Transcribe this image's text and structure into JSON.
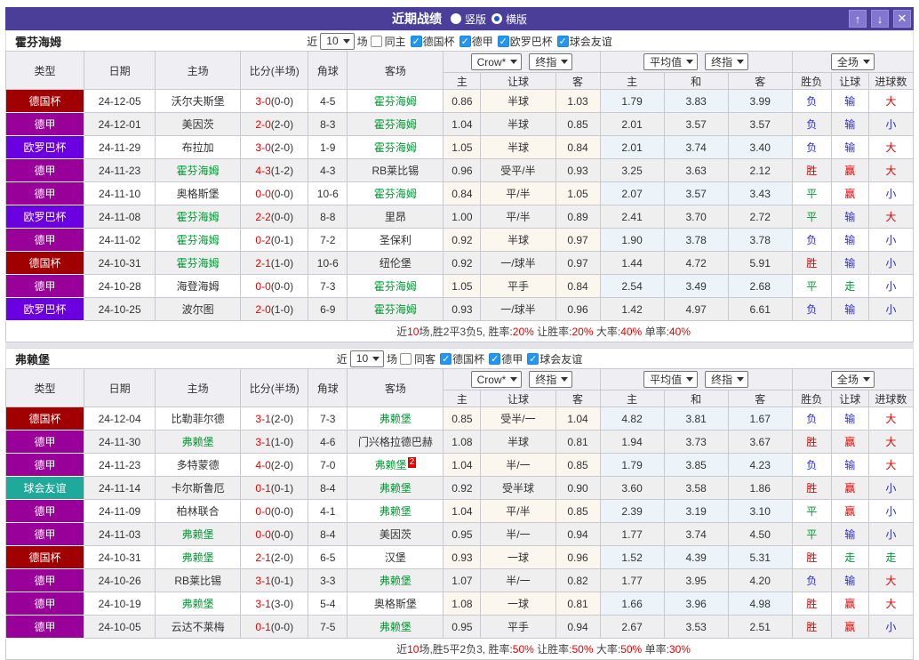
{
  "title_bar": {
    "title": "近期战绩",
    "layout_options": [
      {
        "label": "竖版",
        "selected": false
      },
      {
        "label": "横版",
        "selected": true
      }
    ],
    "buttons": [
      {
        "name": "move-up-button",
        "glyph": "↑"
      },
      {
        "name": "move-down-button",
        "glyph": "↓"
      },
      {
        "name": "close-button",
        "glyph": "✕"
      }
    ]
  },
  "colors": {
    "title_bar_bg": "#4a3e99",
    "type_colors": {
      "德国杯": "#a00000",
      "德甲": "#990099",
      "欧罗巴杯": "#6a00e0",
      "球会友谊": "#1fa99b"
    },
    "focal_team_green": "#009933",
    "win_red": "#e60000",
    "loss_blue": "#2b2bd5",
    "draw_green": "#009933",
    "odds_col_bg": "#fbf6ee",
    "avg_col_bg": "#ecf4fa"
  },
  "header": {
    "static_cols": [
      "类型",
      "日期",
      "主场",
      "比分(半场)",
      "角球",
      "客场"
    ],
    "groups": [
      {
        "selects": [
          {
            "label": "Crow*",
            "name": "bookmaker-select"
          },
          {
            "label": "终指",
            "name": "odds-time-select"
          }
        ],
        "subcols": [
          "主",
          "让球",
          "客"
        ]
      },
      {
        "selects": [
          {
            "label": "平均值",
            "name": "average-select"
          },
          {
            "label": "终指",
            "name": "avg-time-select"
          }
        ],
        "subcols": [
          "主",
          "和",
          "客"
        ]
      },
      {
        "selects": [
          {
            "label": "全场",
            "name": "period-select"
          }
        ],
        "subcols": [
          "胜负",
          "让球",
          "进球数"
        ]
      }
    ]
  },
  "sections": [
    {
      "team": "霍芬海姆",
      "filter": {
        "prefix": "近",
        "count": "10",
        "suffix": "场",
        "same": {
          "label": "同主",
          "checked": false
        },
        "leagues": [
          {
            "label": "德国杯",
            "checked": true
          },
          {
            "label": "德甲",
            "checked": true
          },
          {
            "label": "欧罗巴杯",
            "checked": true
          },
          {
            "label": "球会友谊",
            "checked": true
          }
        ]
      },
      "rows": [
        {
          "type": "德国杯",
          "date": "24-12-05",
          "home": {
            "name": "沃尔夫斯堡",
            "focal": false
          },
          "score": "3-0",
          "half": "(0-0)",
          "corners": "4-5",
          "away": {
            "name": "霍芬海姆",
            "focal": true
          },
          "odds": [
            "0.86",
            "半球",
            "1.03"
          ],
          "avg": [
            "1.79",
            "3.83",
            "3.99"
          ],
          "results": [
            [
              "负",
              "blue"
            ],
            [
              "输",
              "blue"
            ],
            [
              "大",
              "red"
            ]
          ]
        },
        {
          "type": "德甲",
          "date": "24-12-01",
          "home": {
            "name": "美因茨",
            "focal": false
          },
          "score": "2-0",
          "half": "(2-0)",
          "corners": "8-3",
          "away": {
            "name": "霍芬海姆",
            "focal": true
          },
          "odds": [
            "1.04",
            "半球",
            "0.85"
          ],
          "avg": [
            "2.01",
            "3.57",
            "3.57"
          ],
          "results": [
            [
              "负",
              "blue"
            ],
            [
              "输",
              "blue"
            ],
            [
              "小",
              "blue"
            ]
          ]
        },
        {
          "type": "欧罗巴杯",
          "date": "24-11-29",
          "home": {
            "name": "布拉加",
            "focal": false
          },
          "score": "3-0",
          "half": "(2-0)",
          "corners": "1-9",
          "away": {
            "name": "霍芬海姆",
            "focal": true
          },
          "odds": [
            "1.05",
            "半球",
            "0.84"
          ],
          "avg": [
            "2.01",
            "3.74",
            "3.40"
          ],
          "results": [
            [
              "负",
              "blue"
            ],
            [
              "输",
              "blue"
            ],
            [
              "大",
              "red"
            ]
          ]
        },
        {
          "type": "德甲",
          "date": "24-11-23",
          "home": {
            "name": "霍芬海姆",
            "focal": true
          },
          "score": "4-3",
          "half": "(1-2)",
          "corners": "4-3",
          "away": {
            "name": "RB莱比锡",
            "focal": false
          },
          "odds": [
            "0.96",
            "受平/半",
            "0.93"
          ],
          "avg": [
            "3.25",
            "3.63",
            "2.12"
          ],
          "results": [
            [
              "胜",
              "red"
            ],
            [
              "赢",
              "red"
            ],
            [
              "大",
              "red"
            ]
          ]
        },
        {
          "type": "德甲",
          "date": "24-11-10",
          "home": {
            "name": "奥格斯堡",
            "focal": false
          },
          "score": "0-0",
          "half": "(0-0)",
          "corners": "10-6",
          "away": {
            "name": "霍芬海姆",
            "focal": true
          },
          "odds": [
            "0.84",
            "平/半",
            "1.05"
          ],
          "avg": [
            "2.07",
            "3.57",
            "3.43"
          ],
          "results": [
            [
              "平",
              "green"
            ],
            [
              "赢",
              "red"
            ],
            [
              "小",
              "blue"
            ]
          ]
        },
        {
          "type": "欧罗巴杯",
          "date": "24-11-08",
          "home": {
            "name": "霍芬海姆",
            "focal": true
          },
          "score": "2-2",
          "half": "(0-0)",
          "corners": "8-8",
          "away": {
            "name": "里昂",
            "focal": false
          },
          "odds": [
            "1.00",
            "平/半",
            "0.89"
          ],
          "avg": [
            "2.41",
            "3.70",
            "2.72"
          ],
          "results": [
            [
              "平",
              "green"
            ],
            [
              "输",
              "blue"
            ],
            [
              "大",
              "red"
            ]
          ]
        },
        {
          "type": "德甲",
          "date": "24-11-02",
          "home": {
            "name": "霍芬海姆",
            "focal": true
          },
          "score": "0-2",
          "half": "(0-1)",
          "corners": "7-2",
          "away": {
            "name": "圣保利",
            "focal": false
          },
          "odds": [
            "0.92",
            "半球",
            "0.97"
          ],
          "avg": [
            "1.90",
            "3.78",
            "3.78"
          ],
          "results": [
            [
              "负",
              "blue"
            ],
            [
              "输",
              "blue"
            ],
            [
              "小",
              "blue"
            ]
          ]
        },
        {
          "type": "德国杯",
          "date": "24-10-31",
          "home": {
            "name": "霍芬海姆",
            "focal": true
          },
          "score": "2-1",
          "half": "(1-0)",
          "corners": "10-6",
          "away": {
            "name": "纽伦堡",
            "focal": false
          },
          "odds": [
            "0.92",
            "一/球半",
            "0.97"
          ],
          "avg": [
            "1.44",
            "4.72",
            "5.91"
          ],
          "results": [
            [
              "胜",
              "red"
            ],
            [
              "输",
              "blue"
            ],
            [
              "小",
              "blue"
            ]
          ]
        },
        {
          "type": "德甲",
          "date": "24-10-28",
          "home": {
            "name": "海登海姆",
            "focal": false
          },
          "score": "0-0",
          "half": "(0-0)",
          "corners": "7-3",
          "away": {
            "name": "霍芬海姆",
            "focal": true
          },
          "odds": [
            "1.05",
            "平手",
            "0.84"
          ],
          "avg": [
            "2.54",
            "3.49",
            "2.68"
          ],
          "results": [
            [
              "平",
              "green"
            ],
            [
              "走",
              "green"
            ],
            [
              "小",
              "blue"
            ]
          ]
        },
        {
          "type": "欧罗巴杯",
          "date": "24-10-25",
          "home": {
            "name": "波尔图",
            "focal": false
          },
          "score": "2-0",
          "half": "(1-0)",
          "corners": "6-9",
          "away": {
            "name": "霍芬海姆",
            "focal": true
          },
          "odds": [
            "0.93",
            "一/球半",
            "0.96"
          ],
          "avg": [
            "1.42",
            "4.97",
            "6.61"
          ],
          "results": [
            [
              "负",
              "blue"
            ],
            [
              "输",
              "blue"
            ],
            [
              "小",
              "blue"
            ]
          ]
        }
      ],
      "summary": [
        [
          "近",
          false
        ],
        [
          "10",
          true
        ],
        [
          "场,胜2平3负5, 胜率:",
          false
        ],
        [
          "20%",
          true
        ],
        [
          " 让胜率:",
          false
        ],
        [
          "20%",
          true
        ],
        [
          " 大率:",
          false
        ],
        [
          "40%",
          true
        ],
        [
          " 单率:",
          false
        ],
        [
          "40%",
          true
        ]
      ]
    },
    {
      "team": "弗赖堡",
      "filter": {
        "prefix": "近",
        "count": "10",
        "suffix": "场",
        "same": {
          "label": "同客",
          "checked": false
        },
        "leagues": [
          {
            "label": "德国杯",
            "checked": true
          },
          {
            "label": "德甲",
            "checked": true
          },
          {
            "label": "球会友谊",
            "checked": true
          }
        ]
      },
      "rows": [
        {
          "type": "德国杯",
          "date": "24-12-04",
          "home": {
            "name": "比勒菲尔德",
            "focal": false
          },
          "score": "3-1",
          "half": "(2-0)",
          "corners": "7-3",
          "away": {
            "name": "弗赖堡",
            "focal": true
          },
          "odds": [
            "0.85",
            "受半/一",
            "1.04"
          ],
          "avg": [
            "4.82",
            "3.81",
            "1.67"
          ],
          "results": [
            [
              "负",
              "blue"
            ],
            [
              "输",
              "blue"
            ],
            [
              "大",
              "red"
            ]
          ]
        },
        {
          "type": "德甲",
          "date": "24-11-30",
          "home": {
            "name": "弗赖堡",
            "focal": true
          },
          "score": "3-1",
          "half": "(1-0)",
          "corners": "4-6",
          "away": {
            "name": "门兴格拉德巴赫",
            "focal": false
          },
          "odds": [
            "1.08",
            "半球",
            "0.81"
          ],
          "avg": [
            "1.94",
            "3.73",
            "3.67"
          ],
          "results": [
            [
              "胜",
              "red"
            ],
            [
              "赢",
              "red"
            ],
            [
              "大",
              "red"
            ]
          ]
        },
        {
          "type": "德甲",
          "date": "24-11-23",
          "home": {
            "name": "多特蒙德",
            "focal": false
          },
          "score": "4-0",
          "half": "(2-0)",
          "corners": "7-0",
          "away": {
            "name": "弗赖堡",
            "focal": true,
            "sup": "2"
          },
          "odds": [
            "1.04",
            "半/一",
            "0.85"
          ],
          "avg": [
            "1.79",
            "3.85",
            "4.23"
          ],
          "results": [
            [
              "负",
              "blue"
            ],
            [
              "输",
              "blue"
            ],
            [
              "大",
              "red"
            ]
          ]
        },
        {
          "type": "球会友谊",
          "date": "24-11-14",
          "home": {
            "name": "卡尔斯鲁厄",
            "focal": false
          },
          "score": "0-1",
          "half": "(0-1)",
          "corners": "8-4",
          "away": {
            "name": "弗赖堡",
            "focal": true
          },
          "odds": [
            "0.92",
            "受半球",
            "0.90"
          ],
          "avg": [
            "3.60",
            "3.58",
            "1.86"
          ],
          "results": [
            [
              "胜",
              "red"
            ],
            [
              "赢",
              "red"
            ],
            [
              "小",
              "blue"
            ]
          ]
        },
        {
          "type": "德甲",
          "date": "24-11-09",
          "home": {
            "name": "柏林联合",
            "focal": false
          },
          "score": "0-0",
          "half": "(0-0)",
          "corners": "4-1",
          "away": {
            "name": "弗赖堡",
            "focal": true
          },
          "odds": [
            "1.04",
            "平/半",
            "0.85"
          ],
          "avg": [
            "2.39",
            "3.19",
            "3.10"
          ],
          "results": [
            [
              "平",
              "green"
            ],
            [
              "赢",
              "red"
            ],
            [
              "小",
              "blue"
            ]
          ]
        },
        {
          "type": "德甲",
          "date": "24-11-03",
          "home": {
            "name": "弗赖堡",
            "focal": true
          },
          "score": "0-0",
          "half": "(0-0)",
          "corners": "8-4",
          "away": {
            "name": "美因茨",
            "focal": false
          },
          "odds": [
            "0.95",
            "半/一",
            "0.94"
          ],
          "avg": [
            "1.77",
            "3.74",
            "4.50"
          ],
          "results": [
            [
              "平",
              "green"
            ],
            [
              "输",
              "blue"
            ],
            [
              "小",
              "blue"
            ]
          ]
        },
        {
          "type": "德国杯",
          "date": "24-10-31",
          "home": {
            "name": "弗赖堡",
            "focal": true
          },
          "score": "2-1",
          "half": "(2-0)",
          "corners": "6-5",
          "away": {
            "name": "汉堡",
            "focal": false
          },
          "odds": [
            "0.93",
            "一球",
            "0.96"
          ],
          "avg": [
            "1.52",
            "4.39",
            "5.31"
          ],
          "results": [
            [
              "胜",
              "red"
            ],
            [
              "走",
              "green"
            ],
            [
              "走",
              "green"
            ]
          ]
        },
        {
          "type": "德甲",
          "date": "24-10-26",
          "home": {
            "name": "RB莱比锡",
            "focal": false
          },
          "score": "3-1",
          "half": "(0-1)",
          "corners": "3-3",
          "away": {
            "name": "弗赖堡",
            "focal": true
          },
          "odds": [
            "1.07",
            "半/一",
            "0.82"
          ],
          "avg": [
            "1.77",
            "3.95",
            "4.20"
          ],
          "results": [
            [
              "负",
              "blue"
            ],
            [
              "输",
              "blue"
            ],
            [
              "大",
              "red"
            ]
          ]
        },
        {
          "type": "德甲",
          "date": "24-10-19",
          "home": {
            "name": "弗赖堡",
            "focal": true
          },
          "score": "3-1",
          "half": "(3-0)",
          "corners": "5-4",
          "away": {
            "name": "奥格斯堡",
            "focal": false
          },
          "odds": [
            "1.08",
            "一球",
            "0.81"
          ],
          "avg": [
            "1.66",
            "3.96",
            "4.98"
          ],
          "results": [
            [
              "胜",
              "red"
            ],
            [
              "赢",
              "red"
            ],
            [
              "大",
              "red"
            ]
          ]
        },
        {
          "type": "德甲",
          "date": "24-10-05",
          "home": {
            "name": "云达不莱梅",
            "focal": false
          },
          "score": "0-1",
          "half": "(0-0)",
          "corners": "7-5",
          "away": {
            "name": "弗赖堡",
            "focal": true
          },
          "odds": [
            "0.95",
            "平手",
            "0.94"
          ],
          "avg": [
            "2.67",
            "3.53",
            "2.51"
          ],
          "results": [
            [
              "胜",
              "red"
            ],
            [
              "赢",
              "red"
            ],
            [
              "小",
              "blue"
            ]
          ]
        }
      ],
      "summary": [
        [
          "近",
          false
        ],
        [
          "10",
          true
        ],
        [
          "场,胜5平2负3, 胜率:",
          false
        ],
        [
          "50%",
          true
        ],
        [
          " 让胜率:",
          false
        ],
        [
          "50%",
          true
        ],
        [
          " 大率:",
          false
        ],
        [
          "50%",
          true
        ],
        [
          " 单率:",
          false
        ],
        [
          "30%",
          true
        ]
      ]
    }
  ]
}
